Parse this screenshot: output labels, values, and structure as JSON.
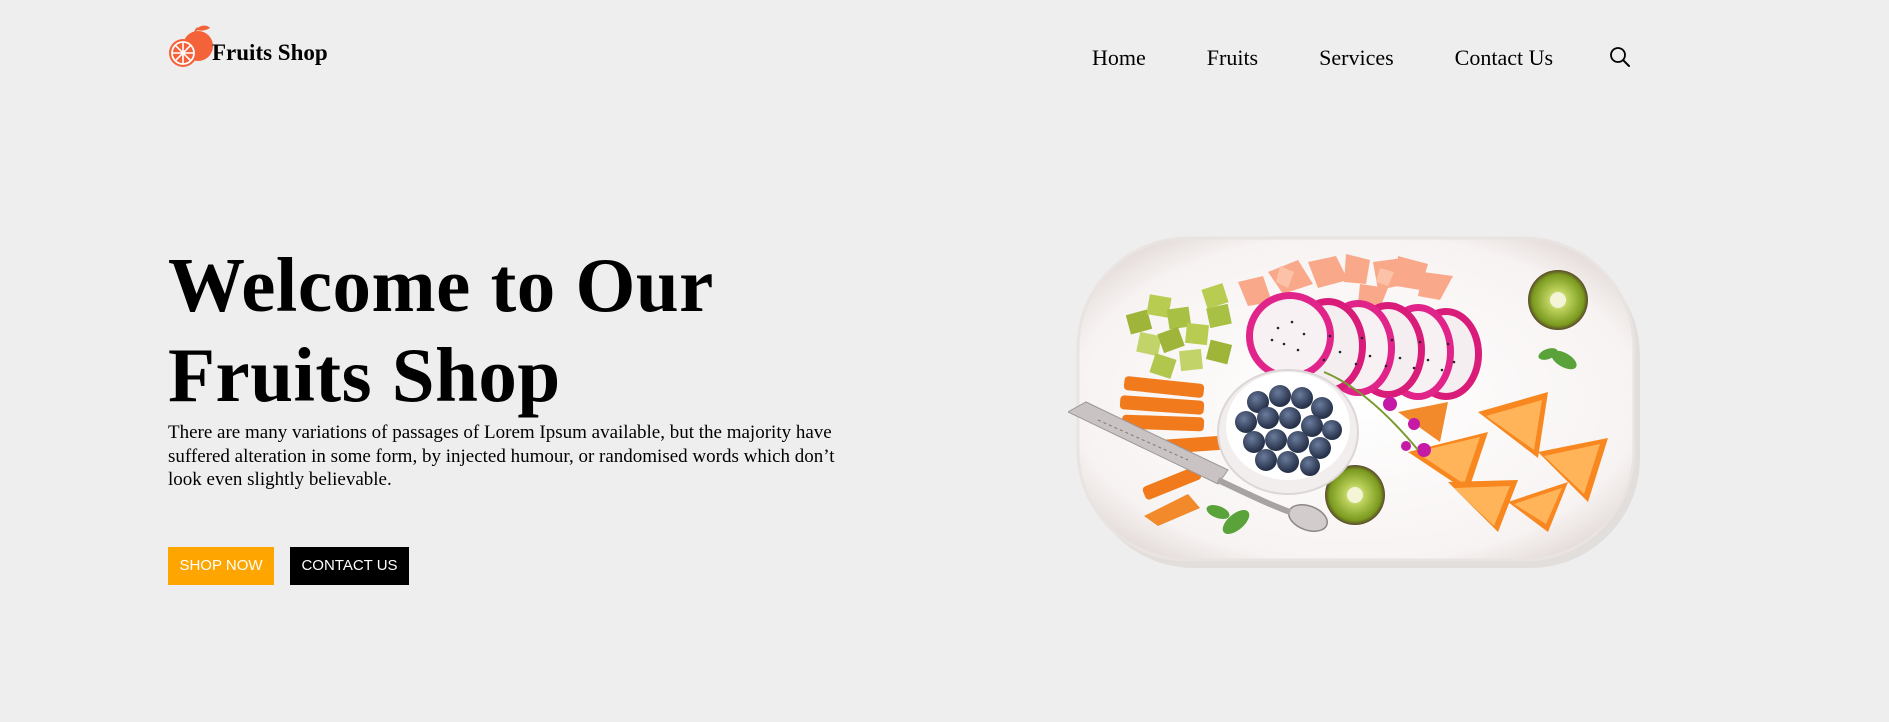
{
  "brand": {
    "name": "Fruits Shop",
    "icon": "orange-slice-icon",
    "color": "#f4623a"
  },
  "nav": {
    "items": [
      "Home",
      "Fruits",
      "Services",
      "Contact Us"
    ],
    "search_icon": "search-icon"
  },
  "hero": {
    "title_line1": "Welcome to Our",
    "title_line2": "Fruits Shop",
    "text": "There are many variations of passages of Lorem Ipsum available, but the majority have suffered alteration in some form, by injected humour, or randomised words which don’t look even slightly believable.",
    "shop_button": "SHOP NOW",
    "contact_button": "CONTACT US",
    "image": "fruit-platter-image"
  },
  "colors": {
    "background": "#eeeeee",
    "accent": "#ffa500",
    "dark": "#000000"
  }
}
